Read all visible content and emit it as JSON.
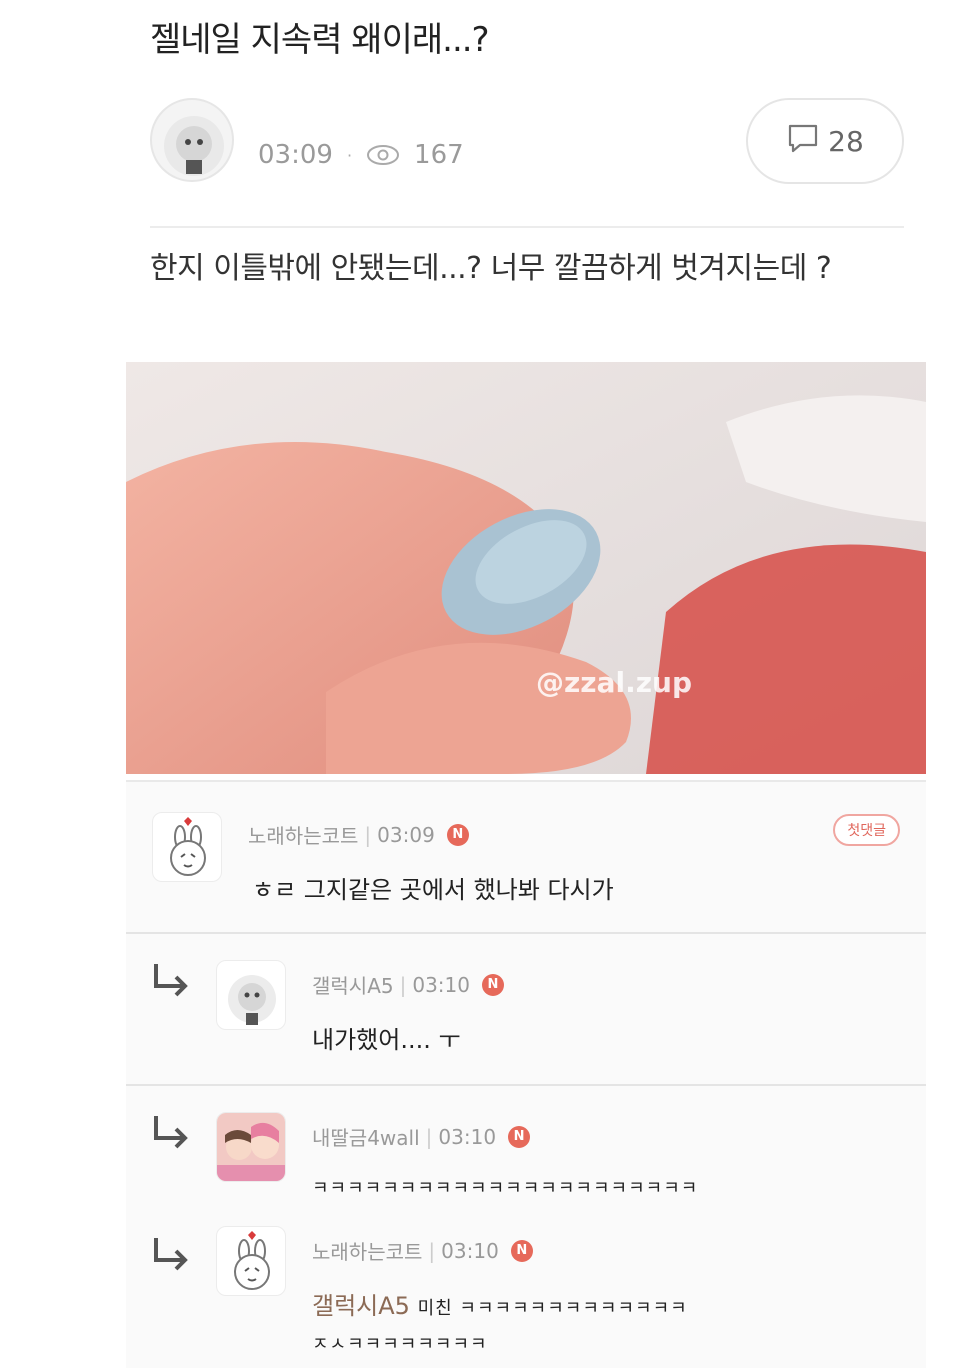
{
  "post": {
    "title": "젤네일 지속력 왜이래...?",
    "time": "03:09",
    "separator": "·",
    "views": "167",
    "comment_count": "28",
    "body": "한지 이틀밖에 안됐는데...? 너무 깔끔하게 벗겨지는데 ?"
  },
  "image": {
    "watermark": "@zzal.zup"
  },
  "comments": [
    {
      "author": "노래하는코트",
      "time": "03:09",
      "badge": "N",
      "first_badge": "첫댓글",
      "text": "ㅎㄹ 그지같은 곳에서 했나봐 다시가",
      "is_reply": false
    },
    {
      "author": "갤럭시A5",
      "time": "03:10",
      "badge": "N",
      "text": "내가했어.... ㅜ",
      "is_reply": true
    },
    {
      "author": "내딸금4wall",
      "time": "03:10",
      "badge": "N",
      "text": "ㅋㅋㅋㅋㅋㅋㅋㅋㅋㅋㅋㅋㅋㅋㅋㅋㅋㅋㅋㅋㅋㅋ",
      "is_reply": true
    },
    {
      "author": "노래하는코트",
      "time": "03:10",
      "badge": "N",
      "mention": "갤럭시A5",
      "text": "미친 ㅋㅋㅋㅋㅋㅋㅋㅋㅋㅋㅋㅋㅋ",
      "text2": "ㅈㅅㅋㅋㅋㅋㅋㅋㅋㅋ",
      "is_reply": true
    }
  ],
  "colors": {
    "accent": "#e6695a",
    "meta_gray": "#9a9a9a",
    "divider": "#e4e4e4"
  },
  "icons": [
    "eye-icon",
    "comment-bubble-icon",
    "reply-arrow-icon"
  ]
}
